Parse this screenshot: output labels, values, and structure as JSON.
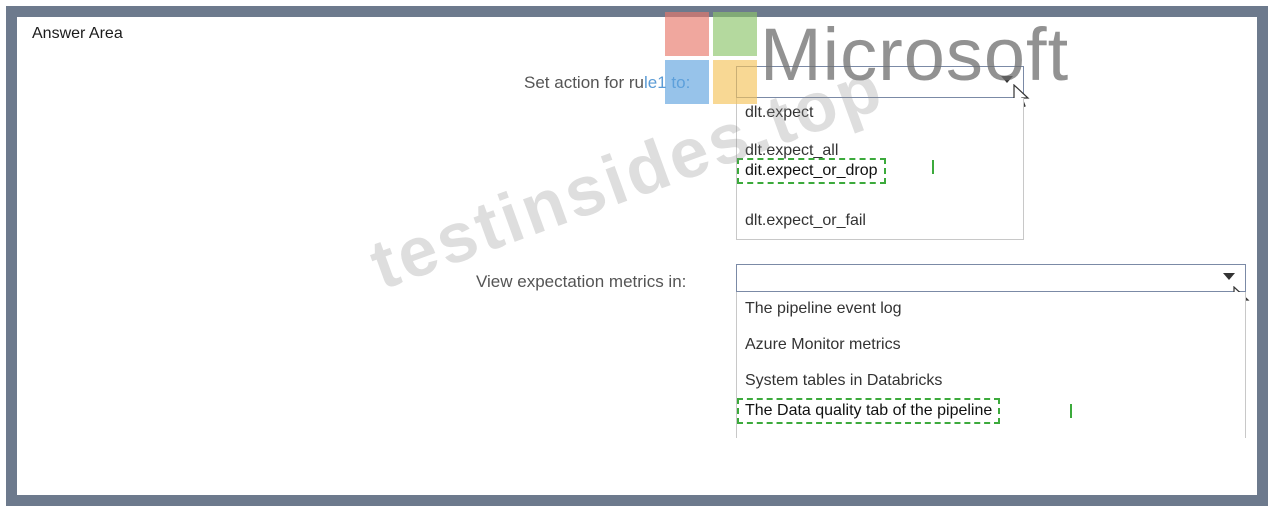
{
  "header": {
    "title": "Answer Area"
  },
  "question1": {
    "label_prefix": "Set action for ru",
    "label_highlight": "le1 to:",
    "selected_value": "",
    "options": [
      "dlt.expect",
      "dlt.expect_all",
      "dit.expect_or_drop",
      "dlt.expect_or_fail"
    ],
    "answer_index": 2
  },
  "question2": {
    "label": "View expectation metrics in:",
    "selected_value": "",
    "options": [
      "The pipeline event log",
      "Azure Monitor metrics",
      "System tables in Databricks",
      "The Data quality tab of the pipeline"
    ],
    "answer_index": 3
  },
  "watermarks": {
    "brand_text": "Microsoft",
    "site_text": "testinsides.top",
    "logo_colors": [
      "#e8786a",
      "#8cc56a",
      "#5fa3de",
      "#f5c35a"
    ]
  }
}
